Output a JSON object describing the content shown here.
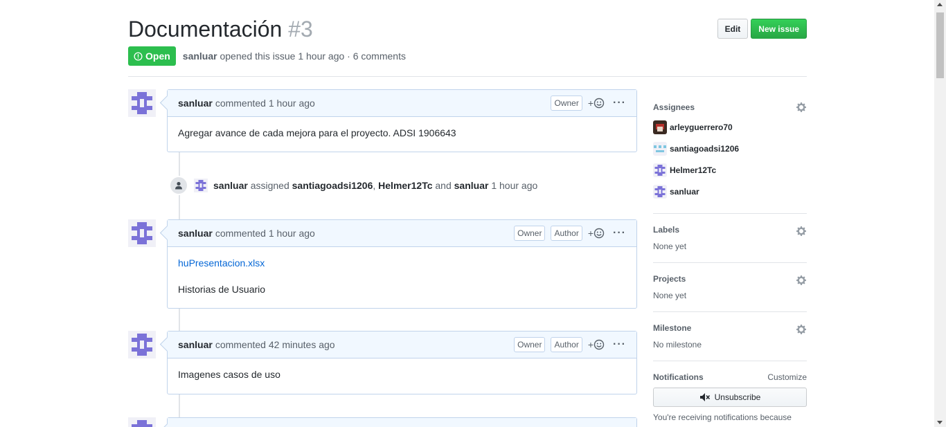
{
  "issue": {
    "title": "Documentación",
    "number": "#3",
    "state": "Open",
    "author": "sanluar",
    "opened_text": "opened this issue 1 hour ago · 6 comments"
  },
  "header": {
    "edit_label": "Edit",
    "new_issue_label": "New issue"
  },
  "comments": [
    {
      "author": "sanluar",
      "action": "commented",
      "time": "1 hour ago",
      "badges": [
        "Owner"
      ],
      "body": [
        "Agregar avance de cada mejora para el proyecto. ADSI 1906643"
      ]
    },
    {
      "author": "sanluar",
      "action": "commented",
      "time": "1 hour ago",
      "badges": [
        "Owner",
        "Author"
      ],
      "link": "huPresentacion.xlsx",
      "body": [
        "Historias de Usuario"
      ]
    },
    {
      "author": "sanluar",
      "action": "commented",
      "time": "42 minutes ago",
      "badges": [
        "Owner",
        "Author"
      ],
      "body": [
        "Imagenes casos de uso"
      ]
    }
  ],
  "event": {
    "actor": "sanluar",
    "verb": "assigned",
    "target1": "santiagoadsi1206",
    "sep1": ",",
    "target2": "Helmer12Tc",
    "and": "and",
    "target3": "sanluar",
    "time": "1 hour ago"
  },
  "reaction_plus": "+",
  "more_dots": "···",
  "sidebar": {
    "assignees_title": "Assignees",
    "assignees": [
      "arleyguerrero70",
      "santiagoadsi1206",
      "Helmer12Tc",
      "sanluar"
    ],
    "labels_title": "Labels",
    "labels_value": "None yet",
    "projects_title": "Projects",
    "projects_value": "None yet",
    "milestone_title": "Milestone",
    "milestone_value": "No milestone",
    "notifications_title": "Notifications",
    "customize_label": "Customize",
    "unsubscribe_label": "Unsubscribe",
    "notifications_note": "You're receiving notifications because"
  },
  "colors": {
    "open_green": "#2cbe4e",
    "link_blue": "#0366d6",
    "identicon_purple": "#7b72d8",
    "comment_header_bg": "#f1f8ff"
  },
  "icons": {
    "state": "issue-opened-icon",
    "reaction": "smiley-icon",
    "gear": "gear-icon",
    "mute": "mute-icon",
    "event": "person-icon"
  }
}
